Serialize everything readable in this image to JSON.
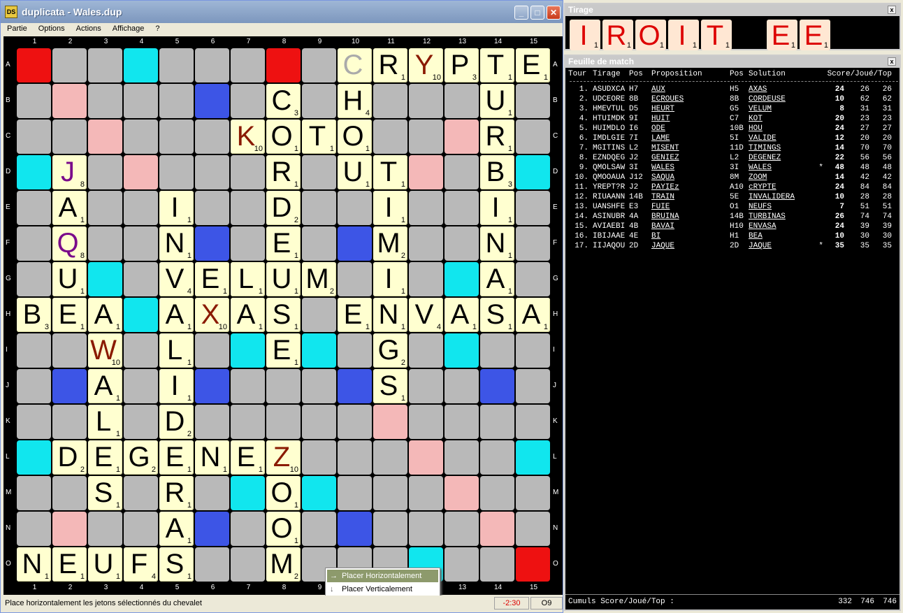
{
  "window": {
    "title": "duplicata - Wales.dup",
    "app_icon": "DS"
  },
  "menu": [
    "Partie",
    "Options",
    "Actions",
    "Affichage",
    "?"
  ],
  "board": {
    "cols": [
      "1",
      "2",
      "3",
      "4",
      "5",
      "6",
      "7",
      "8",
      "9",
      "10",
      "11",
      "12",
      "13",
      "14",
      "15"
    ],
    "rows": [
      "A",
      "B",
      "C",
      "D",
      "E",
      "F",
      "G",
      "H",
      "I",
      "J",
      "K",
      "L",
      "M",
      "N",
      "O"
    ],
    "premium": {
      "tw": [
        "A1",
        "A8",
        "O15"
      ],
      "dw": [
        "B2",
        "C3",
        "D4",
        "K11",
        "L12",
        "M13",
        "N14",
        "C13",
        "D12",
        "L4",
        "M3",
        "N2",
        "B14",
        "K11"
      ],
      "tl": [
        "B6",
        "F6",
        "F10",
        "J2",
        "J6",
        "J10",
        "J14",
        "N6",
        "N10",
        "B10"
      ],
      "dl": [
        "A4",
        "D1",
        "D15",
        "G3",
        "G13",
        "I7",
        "I9",
        "I13",
        "L1",
        "L15",
        "M7",
        "M9",
        "O12",
        "H4"
      ]
    },
    "tiles": [
      {
        "p": "A10",
        "l": "C",
        "v": "",
        "ghost": true
      },
      {
        "p": "A11",
        "l": "R",
        "v": "1"
      },
      {
        "p": "A12",
        "l": "Y",
        "v": "10",
        "c": "#8a1a00"
      },
      {
        "p": "A13",
        "l": "P",
        "v": "3"
      },
      {
        "p": "A14",
        "l": "T",
        "v": "1"
      },
      {
        "p": "A15",
        "l": "E",
        "v": "1"
      },
      {
        "p": "B8",
        "l": "C",
        "v": "3"
      },
      {
        "p": "B10",
        "l": "H",
        "v": "4"
      },
      {
        "p": "B14",
        "l": "U",
        "v": "1"
      },
      {
        "p": "C7",
        "l": "K",
        "v": "10",
        "c": "#8a1a00"
      },
      {
        "p": "C8",
        "l": "O",
        "v": "1"
      },
      {
        "p": "C9",
        "l": "T",
        "v": "1"
      },
      {
        "p": "C10",
        "l": "O",
        "v": "1"
      },
      {
        "p": "C14",
        "l": "R",
        "v": "1"
      },
      {
        "p": "D2",
        "l": "J",
        "v": "8",
        "c": "#7a0a8a"
      },
      {
        "p": "D8",
        "l": "R",
        "v": "1"
      },
      {
        "p": "D10",
        "l": "U",
        "v": "1"
      },
      {
        "p": "D11",
        "l": "T",
        "v": "1"
      },
      {
        "p": "D14",
        "l": "B",
        "v": "3"
      },
      {
        "p": "E2",
        "l": "A",
        "v": "1"
      },
      {
        "p": "E5",
        "l": "I",
        "v": "1"
      },
      {
        "p": "E8",
        "l": "D",
        "v": "2"
      },
      {
        "p": "E11",
        "l": "I",
        "v": "1"
      },
      {
        "p": "E14",
        "l": "I",
        "v": "1"
      },
      {
        "p": "F2",
        "l": "Q",
        "v": "8",
        "c": "#7a0a8a"
      },
      {
        "p": "F5",
        "l": "N",
        "v": "1"
      },
      {
        "p": "F8",
        "l": "E",
        "v": "1"
      },
      {
        "p": "F11",
        "l": "M",
        "v": "2"
      },
      {
        "p": "F14",
        "l": "N",
        "v": "1"
      },
      {
        "p": "G2",
        "l": "U",
        "v": "1"
      },
      {
        "p": "G5",
        "l": "V",
        "v": "4"
      },
      {
        "p": "G6",
        "l": "E",
        "v": "1"
      },
      {
        "p": "G7",
        "l": "L",
        "v": "1"
      },
      {
        "p": "G8",
        "l": "U",
        "v": "1"
      },
      {
        "p": "G9",
        "l": "M",
        "v": "2"
      },
      {
        "p": "G11",
        "l": "I",
        "v": "1"
      },
      {
        "p": "G14",
        "l": "A",
        "v": "1"
      },
      {
        "p": "H1",
        "l": "B",
        "v": "3"
      },
      {
        "p": "H2",
        "l": "E",
        "v": "1"
      },
      {
        "p": "H3",
        "l": "A",
        "v": "1"
      },
      {
        "p": "H5",
        "l": "A",
        "v": "1"
      },
      {
        "p": "H6",
        "l": "X",
        "v": "10",
        "c": "#8a1a00"
      },
      {
        "p": "H7",
        "l": "A",
        "v": "1"
      },
      {
        "p": "H8",
        "l": "S",
        "v": "1"
      },
      {
        "p": "H10",
        "l": "E",
        "v": "1"
      },
      {
        "p": "H11",
        "l": "N",
        "v": "1"
      },
      {
        "p": "H12",
        "l": "V",
        "v": "4"
      },
      {
        "p": "H13",
        "l": "A",
        "v": "1"
      },
      {
        "p": "H14",
        "l": "S",
        "v": "1"
      },
      {
        "p": "H15",
        "l": "A",
        "v": "1"
      },
      {
        "p": "I3",
        "l": "W",
        "v": "10",
        "c": "#8a1a00"
      },
      {
        "p": "I5",
        "l": "L",
        "v": "1"
      },
      {
        "p": "I8",
        "l": "E",
        "v": "1"
      },
      {
        "p": "I11",
        "l": "G",
        "v": "2"
      },
      {
        "p": "J3",
        "l": "A",
        "v": "1"
      },
      {
        "p": "J5",
        "l": "I",
        "v": "1"
      },
      {
        "p": "J11",
        "l": "S",
        "v": "1"
      },
      {
        "p": "K3",
        "l": "L",
        "v": "1"
      },
      {
        "p": "K5",
        "l": "D",
        "v": "2"
      },
      {
        "p": "L2",
        "l": "D",
        "v": "2"
      },
      {
        "p": "L3",
        "l": "E",
        "v": "1"
      },
      {
        "p": "L4",
        "l": "G",
        "v": "2"
      },
      {
        "p": "L5",
        "l": "E",
        "v": "1"
      },
      {
        "p": "L6",
        "l": "N",
        "v": "1"
      },
      {
        "p": "L7",
        "l": "E",
        "v": "1"
      },
      {
        "p": "L8",
        "l": "Z",
        "v": "10",
        "c": "#8a1a00"
      },
      {
        "p": "M3",
        "l": "S",
        "v": "1"
      },
      {
        "p": "M5",
        "l": "R",
        "v": "1"
      },
      {
        "p": "M8",
        "l": "O",
        "v": "1"
      },
      {
        "p": "N5",
        "l": "A",
        "v": "1"
      },
      {
        "p": "N8",
        "l": "O",
        "v": "1"
      },
      {
        "p": "O1",
        "l": "N",
        "v": "1"
      },
      {
        "p": "O2",
        "l": "E",
        "v": "1"
      },
      {
        "p": "O3",
        "l": "U",
        "v": "1"
      },
      {
        "p": "O4",
        "l": "F",
        "v": "4"
      },
      {
        "p": "O5",
        "l": "S",
        "v": "1"
      },
      {
        "p": "O8",
        "l": "M",
        "v": "2"
      }
    ]
  },
  "context_menu": {
    "items": [
      "Placer Horizontalement",
      "Placer Verticalement"
    ]
  },
  "status": {
    "text": "Place horizontalement les jetons sélectionnés du chevalet",
    "timer": "-2:30",
    "pos": "O9"
  },
  "tirage": {
    "title": "Tirage",
    "tiles": [
      {
        "l": "I",
        "v": "1"
      },
      {
        "l": "R",
        "v": "1"
      },
      {
        "l": "O",
        "v": "1"
      },
      {
        "l": "I",
        "v": "1"
      },
      {
        "l": "T",
        "v": "1"
      },
      {
        "l": "",
        "v": ""
      },
      {
        "l": "E",
        "v": "1"
      },
      {
        "l": "E",
        "v": "1"
      }
    ]
  },
  "feuille": {
    "title": "Feuille de match",
    "headers": {
      "tour": "Tour",
      "tirage": "Tirage",
      "pos": "Pos",
      "prop": "Proposition",
      "pos2": "Pos",
      "sol": "Solution",
      "score": "Score/Joué/Top"
    },
    "rows": [
      [
        "1.",
        "ASUDXCA",
        "H7",
        "AUX",
        "H5",
        "AXAS",
        "",
        "24",
        "26",
        "26"
      ],
      [
        "2.",
        "UDCEORE",
        "8B",
        "ECROUES",
        "8B",
        "CORDEUSE",
        "",
        "10",
        "62",
        "62"
      ],
      [
        "3.",
        "HMEVTUL",
        "D5",
        "HEURT",
        "G5",
        "VELUM",
        "",
        "8",
        "31",
        "31"
      ],
      [
        "4.",
        "HTUIMDK",
        "9I",
        "HUIT",
        "C7",
        "KOT",
        "",
        "20",
        "23",
        "23"
      ],
      [
        "5.",
        "HUIMDLO",
        "I6",
        "ODE",
        "10B",
        "HOU",
        "",
        "24",
        "27",
        "27"
      ],
      [
        "6.",
        "IMDLGIE",
        "7I",
        "LAME",
        "5I",
        "VALIDE",
        "",
        "12",
        "20",
        "20"
      ],
      [
        "7.",
        "MGITINS",
        "L2",
        "MISENT",
        "11D",
        "TIMINGS",
        "",
        "14",
        "70",
        "70"
      ],
      [
        "8.",
        "EZNDQEG",
        "J2",
        "GENIEZ",
        "L2",
        "DEGENEZ",
        "",
        "22",
        "56",
        "56"
      ],
      [
        "9.",
        "QMOLSAW",
        "3I",
        "WALES",
        "3I",
        "WALES",
        "*",
        "48",
        "48",
        "48"
      ],
      [
        "10.",
        "QMOOAUA",
        "J12",
        "SAQUA",
        "8M",
        "ZOOM",
        "",
        "14",
        "42",
        "42"
      ],
      [
        "11.",
        "YREPT?R",
        "J2",
        "PAYIEz",
        "A10",
        "cRYPTE",
        "",
        "24",
        "84",
        "84"
      ],
      [
        "12.",
        "RIUAANN",
        "14B",
        "TRAIN",
        "5E",
        "INVALIDERA",
        "",
        "10",
        "28",
        "28"
      ],
      [
        "13.",
        "UANSHFE",
        "E3",
        "FUIE",
        "O1",
        "NEUFS",
        "",
        "7",
        "51",
        "51"
      ],
      [
        "14.",
        "ASINUBR",
        "4A",
        "BRUINA",
        "14B",
        "TURBINAS",
        "",
        "26",
        "74",
        "74"
      ],
      [
        "15.",
        "AVIAEBI",
        "4B",
        "BAVAI",
        "H10",
        "ENVASA",
        "",
        "24",
        "39",
        "39"
      ],
      [
        "16.",
        "IBIJAAE",
        "4E",
        "BI",
        "H1",
        "BEA",
        "",
        "10",
        "30",
        "30"
      ],
      [
        "17.",
        "IIJAQOU",
        "2D",
        "JAQUE",
        "2D",
        "JAQUE",
        "*",
        "35",
        "35",
        "35"
      ]
    ],
    "cumul": {
      "label": "Cumuls Score/Joué/Top :",
      "score": "332",
      "joue": "746",
      "top": "746"
    }
  }
}
